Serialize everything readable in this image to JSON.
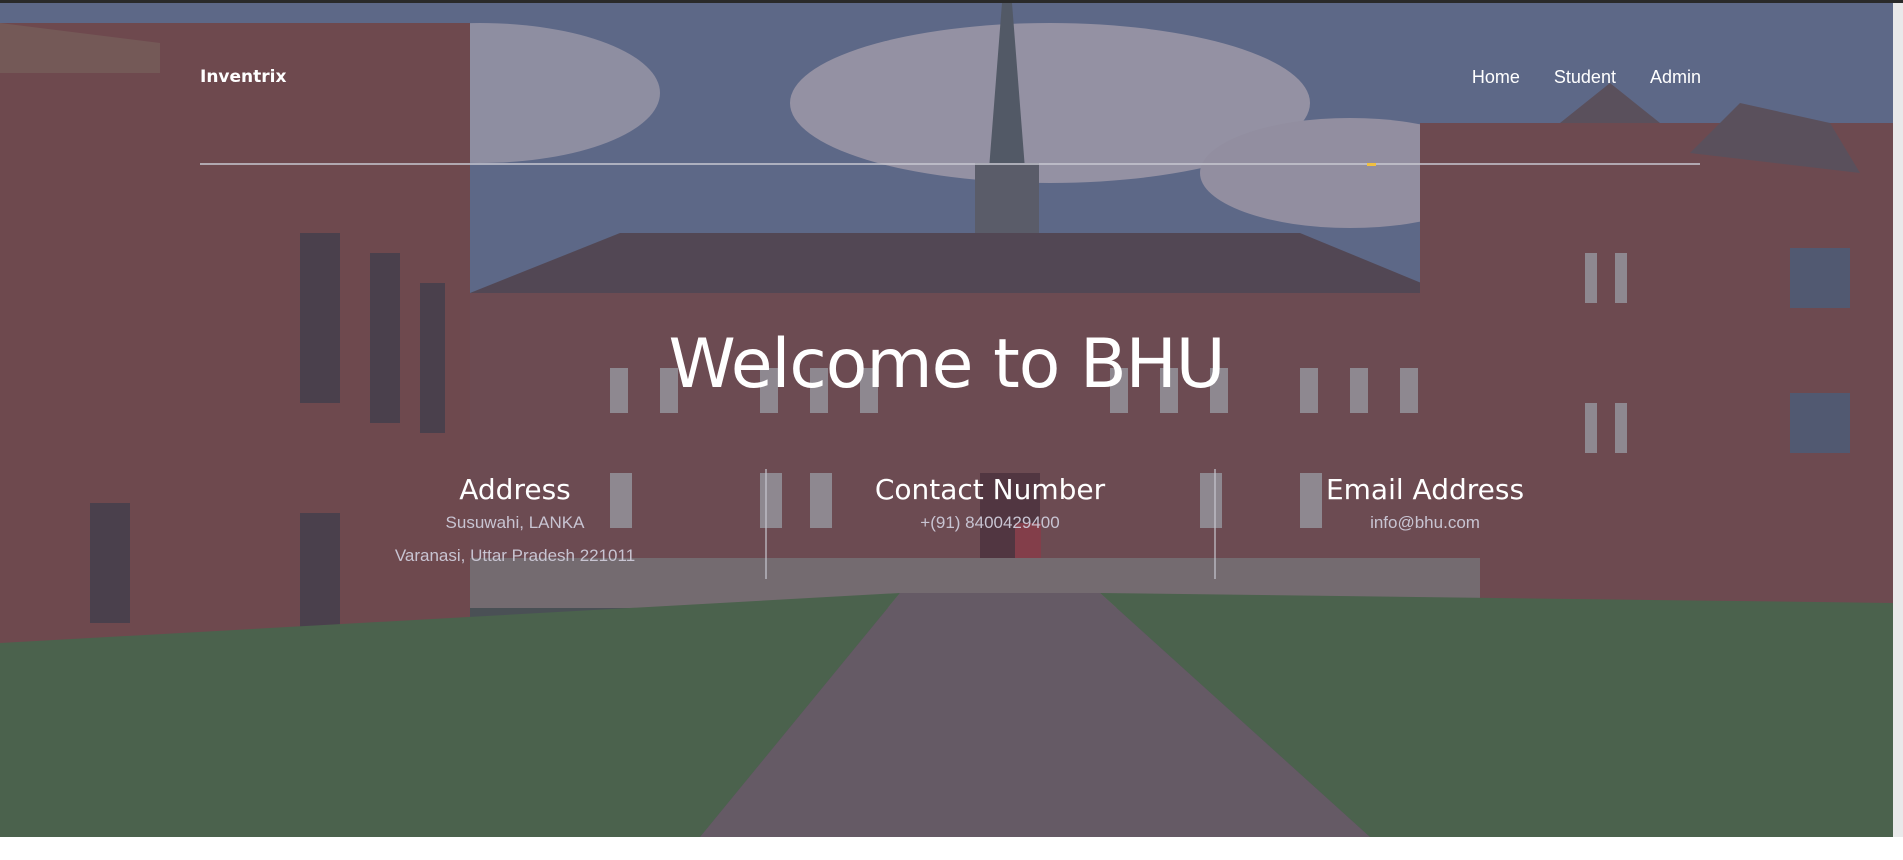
{
  "header": {
    "brand": "Inventrix",
    "nav": [
      {
        "label": "Home"
      },
      {
        "label": "Student"
      },
      {
        "label": "Admin"
      }
    ]
  },
  "hero": {
    "title": "Welcome to BHU",
    "background": "campus-building-photo"
  },
  "info": {
    "address": {
      "heading": "Address",
      "line1": "Susuwahi, LANKA",
      "line2": "Varanasi, Uttar Pradesh 221011"
    },
    "contact": {
      "heading": "Contact Number",
      "line1": "+(91) 8400429400"
    },
    "email": {
      "heading": "Email Address",
      "line1": "info@bhu.com"
    }
  },
  "colors": {
    "overlay": "#46445f",
    "text": "#ffffff",
    "muted_text": "#c8c4d2",
    "accent": "#f0c040"
  }
}
